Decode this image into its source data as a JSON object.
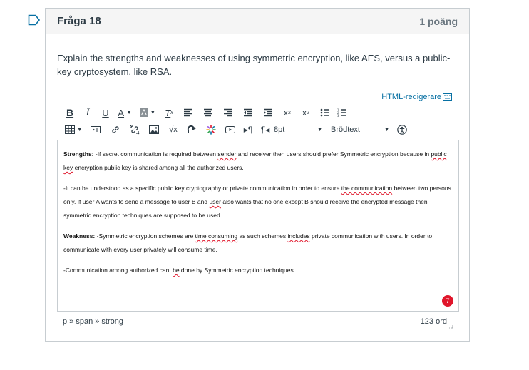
{
  "question": {
    "title": "Fråga 18",
    "points": "1 poäng",
    "text": "Explain the strengths and weaknesses of using symmetric encryption, like AES, versus a public-key cryptosystem, like RSA."
  },
  "editor": {
    "html_switch_label": "HTML-redigerare",
    "font_size": "8pt",
    "block_format": "Brödtext",
    "content": {
      "strengths_label": "Strengths:",
      "p1_a": " -If secret communication is required between ",
      "p1_sp1": "sender",
      "p1_b": " and receiver then users should prefer Symmetric encryption because in ",
      "p1_sp2": "public key",
      "p1_c": " encryption public key is shared among all the authorized users.",
      "p2_a": "-It can be understood as a specific public key cryptography or private communication in order to ensure ",
      "p2_sp1": "the communication",
      "p2_b": " between two persons only. If user A wants to send a message to user B and ",
      "p2_sp2": "user",
      "p2_c": " also wants that no one except B should receive the encrypted message then symmetric encryption techniques are supposed to be used.",
      "weakness_label": "Weakness:",
      "p3_a": " -Symmetric encryption schemes are ",
      "p3_sp1": "time  consuming",
      "p3_b": " as such schemes ",
      "p3_sp2": "includes",
      "p3_c": " private communication with users. In order to communicate with every user privately will consume time.",
      "p4_a": "-Communication among authorized cant ",
      "p4_sp1": "be",
      "p4_b": " done by Symmetric encryption techniques."
    },
    "spellcheck_count": "7",
    "path": "p » span » strong",
    "word_count": "123 ord"
  },
  "colors": {
    "link": "#0770a3",
    "error": "#e0162b",
    "border": "#c7cdd1"
  },
  "icons": [
    "flag-icon",
    "bold-icon",
    "italic-icon",
    "underline-icon",
    "text-color-icon",
    "background-color-icon",
    "clear-formatting-icon",
    "align-left-icon",
    "align-center-icon",
    "align-right-icon",
    "outdent-icon",
    "indent-icon",
    "superscript-icon",
    "subscript-icon",
    "bullet-list-icon",
    "numbered-list-icon",
    "table-icon",
    "media-icon",
    "link-icon",
    "unlink-icon",
    "image-icon",
    "math-icon",
    "embed-icon",
    "apps-icon",
    "record-media-icon",
    "ltr-icon",
    "rtl-icon",
    "accessibility-icon",
    "keyboard-icon",
    "resize-icon"
  ]
}
